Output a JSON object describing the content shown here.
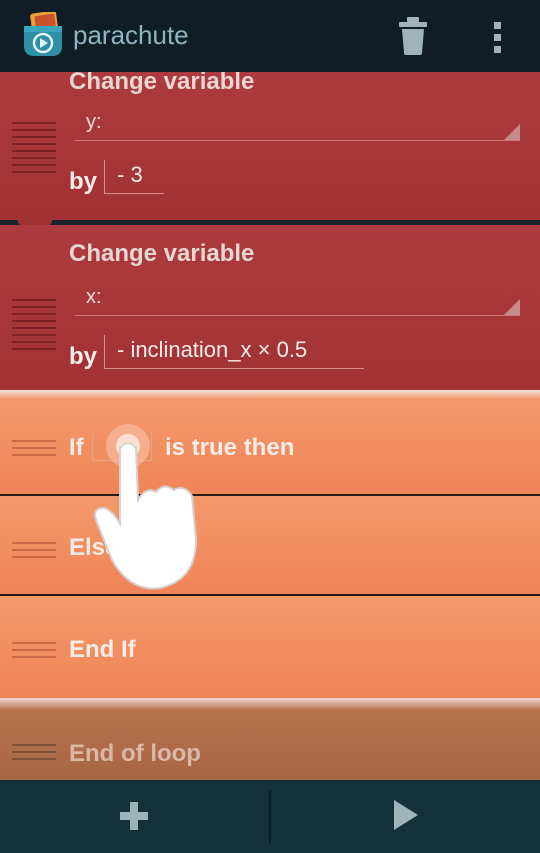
{
  "actionbar": {
    "title": "parachute",
    "app_icon": "pocket-code-icon",
    "delete_icon": "trash-icon",
    "menu_icon": "overflow-menu-icon"
  },
  "bricks": [
    {
      "type": "change-variable",
      "title": "Change variable",
      "variable": "y:",
      "by_label": "by",
      "value": "- 3",
      "color": "#a8373a"
    },
    {
      "type": "change-variable",
      "title": "Change variable",
      "variable": "x:",
      "by_label": "by",
      "value": "- inclination_x × 0.5",
      "color": "#a8373a"
    },
    {
      "type": "if",
      "prefix": "If",
      "suffix": "is true then",
      "color": "#f28f61"
    },
    {
      "type": "else",
      "label": "Else",
      "color": "#f28f61"
    },
    {
      "type": "end-if",
      "label": "End If",
      "color": "#f28f61"
    },
    {
      "type": "end-loop",
      "label": "End of loop",
      "color": "#ad6b48"
    }
  ],
  "bottombar": {
    "add_icon": "plus-icon",
    "play_icon": "play-icon"
  }
}
